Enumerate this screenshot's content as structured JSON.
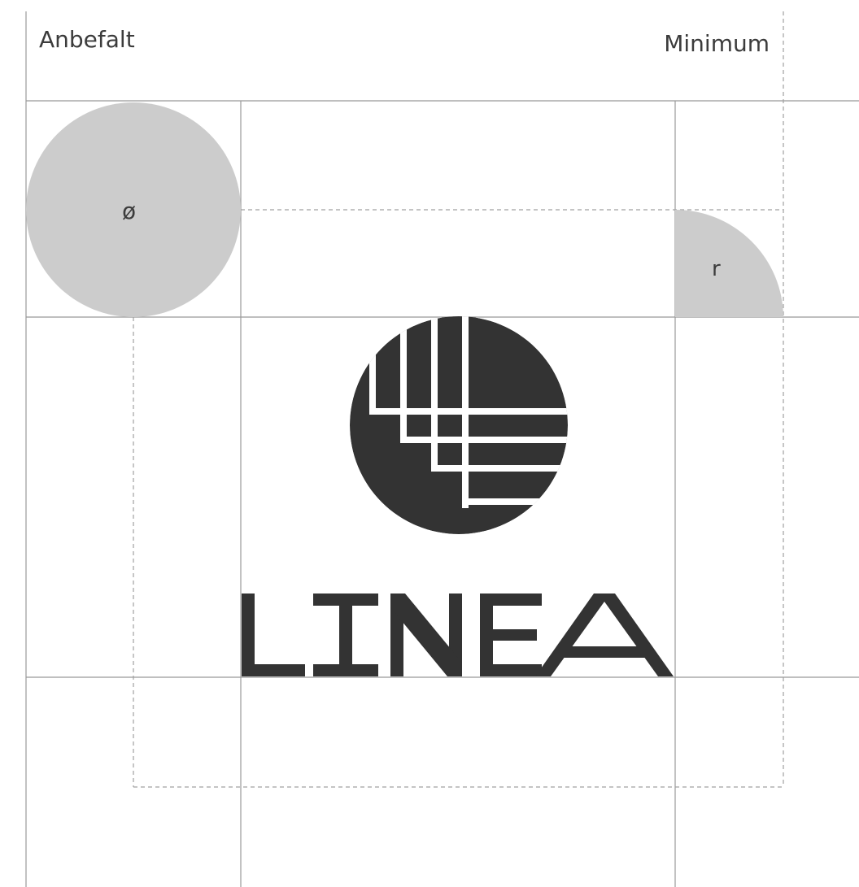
{
  "labels": {
    "recommended": "Anbefalt",
    "minimum": "Minimum",
    "diameter_symbol": "ø",
    "radius_symbol": "r"
  },
  "logo": {
    "wordmark": "LINEA",
    "color": "#333333"
  },
  "colors": {
    "guide_line": "#999999",
    "dashed_line": "#a0a0a0",
    "shape_fill": "#cccccc",
    "text": "#3c3c3c"
  }
}
